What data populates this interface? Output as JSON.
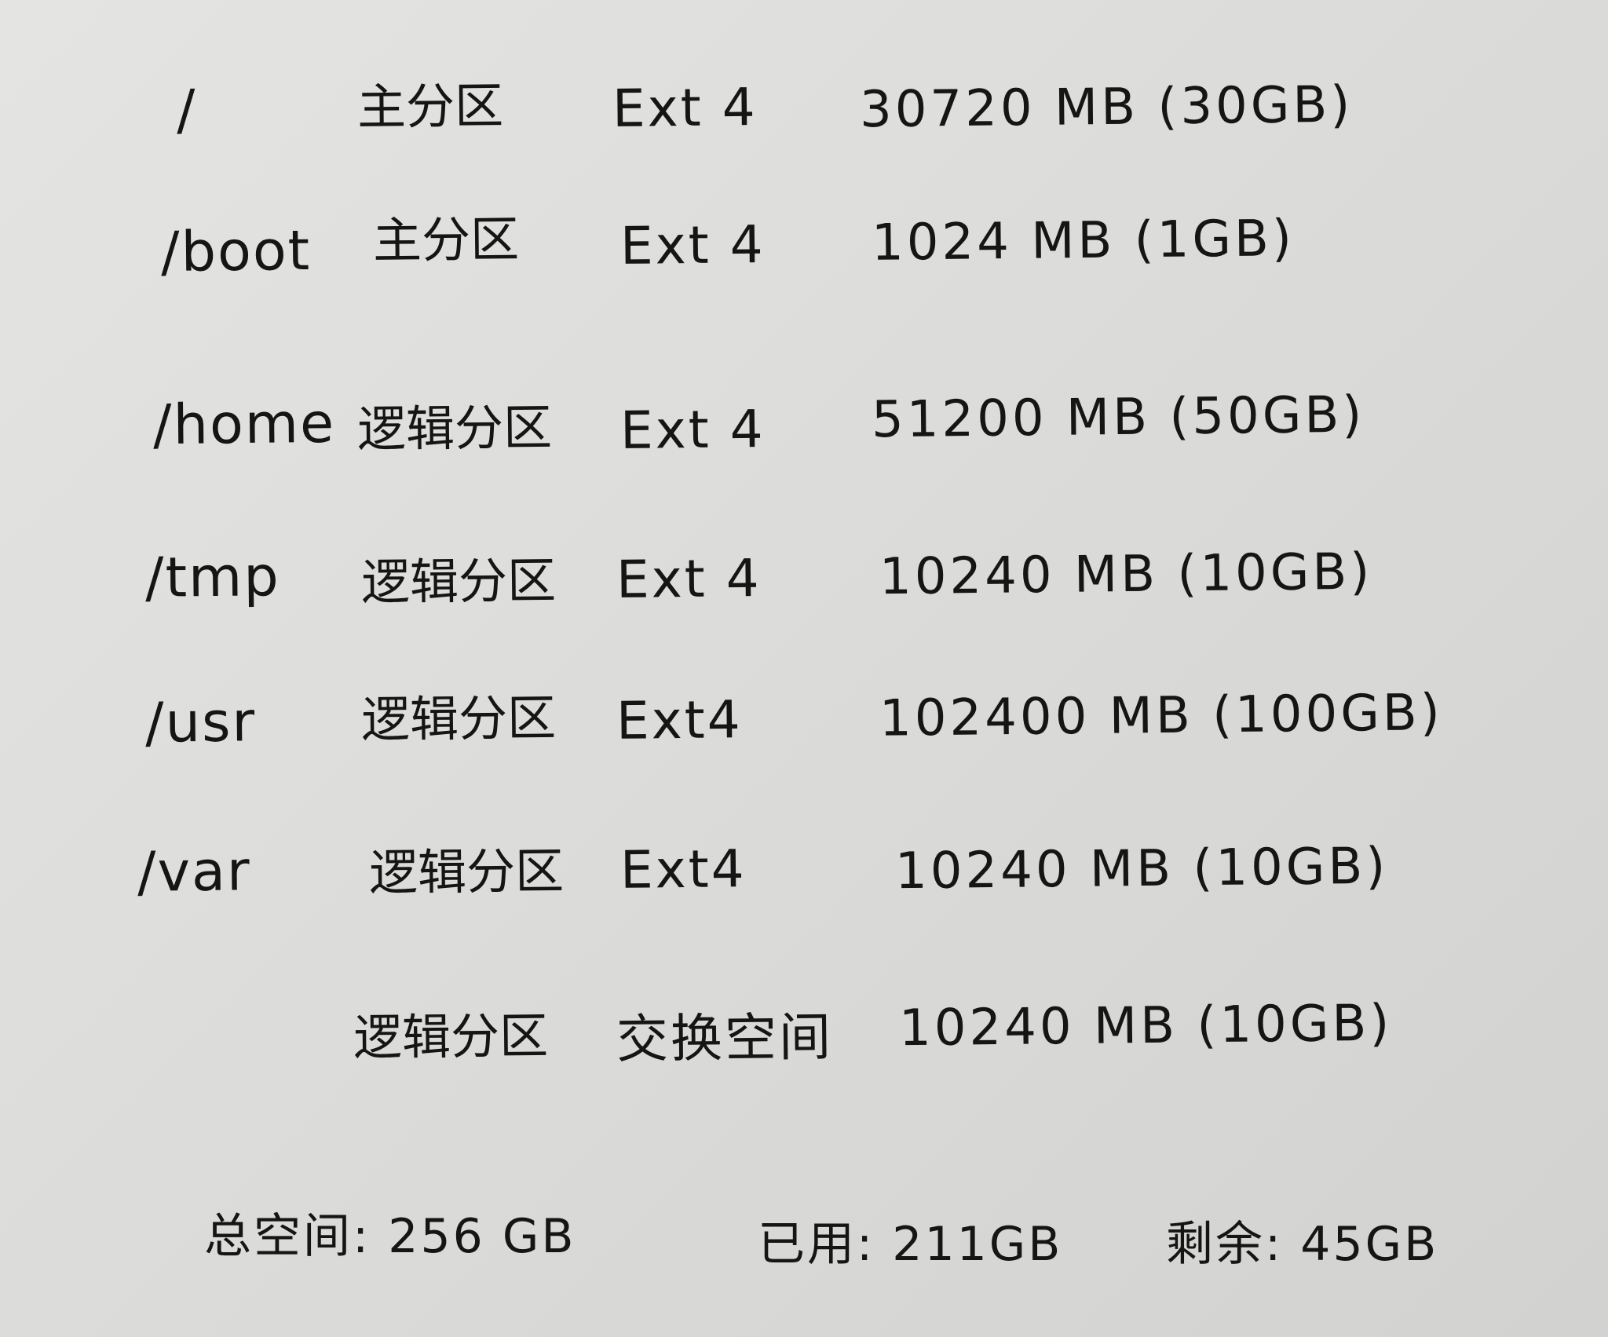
{
  "partitions": [
    {
      "mount": "/",
      "type": "主分区",
      "fs": "Ext 4",
      "size": "30720 MB (30GB)"
    },
    {
      "mount": "/boot",
      "type": "主分区",
      "fs": "Ext 4",
      "size": "1024 MB (1GB)"
    },
    {
      "mount": "/home",
      "type": "逻辑分区",
      "fs": "Ext 4",
      "size": "51200 MB (50GB)"
    },
    {
      "mount": "/tmp",
      "type": "逻辑分区",
      "fs": "Ext 4",
      "size": "10240 MB (10GB)"
    },
    {
      "mount": "/usr",
      "type": "逻辑分区",
      "fs": "Ext4",
      "size": "102400 MB (100GB)"
    },
    {
      "mount": "/var",
      "type": "逻辑分区",
      "fs": "Ext4",
      "size": "10240 MB (10GB)"
    },
    {
      "mount": "",
      "type": "逻辑分区",
      "fs": "交换空间",
      "size": "10240 MB (10GB)"
    }
  ],
  "summary": {
    "total": "总空间: 256 GB",
    "used": "已用: 211GB",
    "remaining": "剩余: 45GB"
  }
}
